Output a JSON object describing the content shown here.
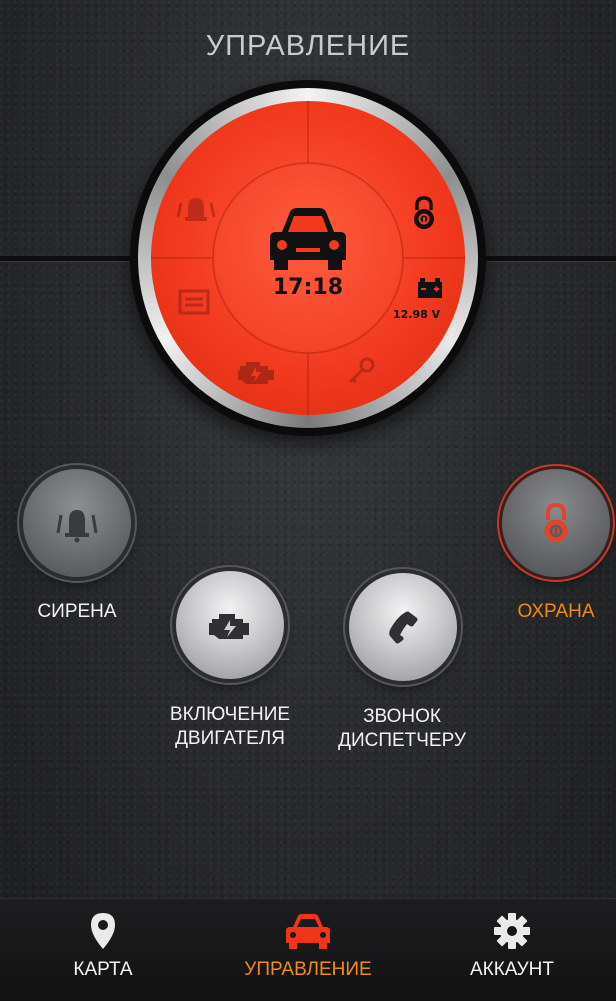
{
  "header": {
    "title": "УПРАВЛЕНИЕ"
  },
  "dial": {
    "time": "17:18",
    "voltage": "12.98 V",
    "segments": [
      "siren-icon",
      "lock-icon",
      "garage-icon",
      "battery-icon",
      "engine-icon",
      "key-icon"
    ],
    "center_icon": "car-icon",
    "face_color": "#f23a1f"
  },
  "buttons": {
    "siren": {
      "label": "СИРЕНА",
      "icon": "siren-icon"
    },
    "engine": {
      "label_line1": "ВКЛЮЧЕНИЕ",
      "label_line2": "ДВИГАТЕЛЯ",
      "icon": "engine-icon"
    },
    "call": {
      "label_line1": "ЗВОНОК",
      "label_line2": "ДИСПЕТЧЕРУ",
      "icon": "phone-icon"
    },
    "guard": {
      "label": "ОХРАНА",
      "icon": "lock-icon",
      "active": true
    }
  },
  "bottom_nav": {
    "items": [
      {
        "label": "КАРТА",
        "icon": "map-pin-icon",
        "active": false
      },
      {
        "label": "УПРАВЛЕНИЕ",
        "icon": "car-icon",
        "active": true
      },
      {
        "label": "АККАУНТ",
        "icon": "gear-icon",
        "active": false
      }
    ]
  },
  "colors": {
    "accent": "#f08a1c",
    "red": "#f23a1f",
    "text": "#f2f2f2"
  }
}
